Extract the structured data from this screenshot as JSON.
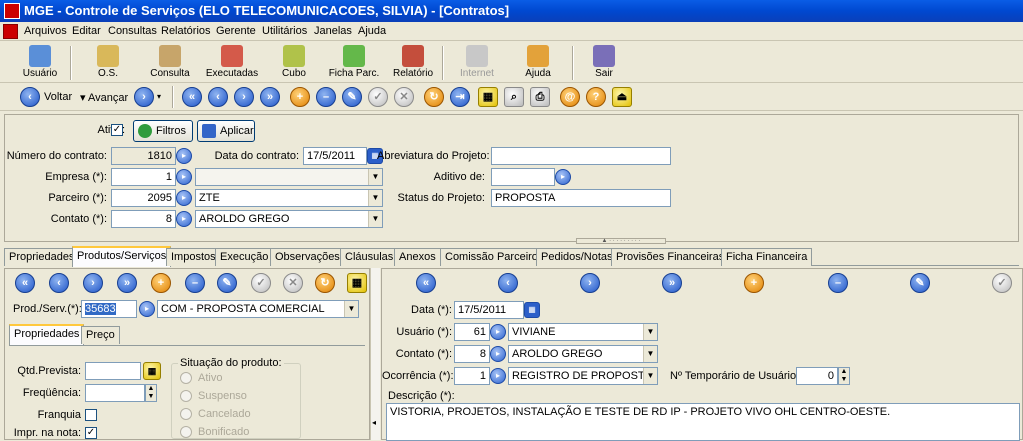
{
  "window": {
    "title": "MGE - Controle de Serviços (ELO TELECOMUNICACOES, SILVIA) - [Contratos]"
  },
  "menu": [
    "Arquivos",
    "Editar",
    "Consultas",
    "Relatórios",
    "Gerente",
    "Utilitários",
    "Janelas",
    "Ajuda"
  ],
  "toolbar1": [
    {
      "label": "Usuário",
      "icon": "user-icon"
    },
    {
      "label": "O.S.",
      "icon": "service-order-icon"
    },
    {
      "label": "Consulta",
      "icon": "query-icon"
    },
    {
      "label": "Executadas",
      "icon": "executed-icon"
    },
    {
      "label": "Cubo",
      "icon": "cube-icon"
    },
    {
      "label": "Ficha Parc.",
      "icon": "partial-sheet-icon"
    },
    {
      "label": "Relatório",
      "icon": "report-icon"
    },
    {
      "label": "Internet",
      "icon": "internet-icon"
    },
    {
      "label": "Ajuda",
      "icon": "help-icon"
    },
    {
      "label": "Sair",
      "icon": "exit-icon"
    }
  ],
  "nav": {
    "back": "Voltar",
    "forward": "Avançar"
  },
  "form": {
    "ativo_label": "Ativo:",
    "filtros": "Filtros",
    "aplicar": "Aplicar",
    "numero_label": "Número do contrato:",
    "numero_value": "1810",
    "data_label": "Data do contrato:",
    "data_value": "17/5/2011",
    "abrev_label": "Abreviatura do Projeto:",
    "abrev_value": "",
    "empresa_label": "Empresa (*):",
    "empresa_code": "1",
    "empresa_name": "",
    "aditivo_label": "Aditivo de:",
    "aditivo_value": "",
    "parceiro_label": "Parceiro (*):",
    "parceiro_code": "2095",
    "parceiro_name": "ZTE",
    "status_label": "Status do Projeto:",
    "status_value": "PROPOSTA",
    "contato_label": "Contato (*):",
    "contato_code": "8",
    "contato_name": "AROLDO GREGO"
  },
  "tabs": [
    "Propriedades",
    "Produtos/Serviços",
    "Impostos",
    "Execução",
    "Observações",
    "Cláusulas",
    "Anexos",
    "Comissão Parceiros",
    "Pedidos/Notas",
    "Provisões Financeiras",
    "Ficha Financeira"
  ],
  "active_tab": "Produtos/Serviços",
  "left": {
    "prod_label": "Prod./Serv.(*):",
    "prod_code": "35683",
    "prod_name": "COM - PROPOSTA COMERCIAL",
    "subtabs": [
      "Propriedades",
      "Preço"
    ],
    "qtd_label": "Qtd.Prevista:",
    "qtd_value": "",
    "freq_label": "Freqüência:",
    "freq_value": "",
    "franquia_label": "Franquia",
    "impr_label": "Impr. na nota:",
    "situacao_title": "Situação do produto:",
    "situacao_options": [
      "Ativo",
      "Suspenso",
      "Cancelado",
      "Bonificado"
    ]
  },
  "right": {
    "data_label": "Data (*):",
    "data_value": "17/5/2011",
    "usuario_label": "Usuário (*):",
    "usuario_code": "61",
    "usuario_name": "VIVIANE",
    "contato_label": "Contato (*):",
    "contato_code": "8",
    "contato_name": "AROLDO GREGO",
    "ocorrencia_label": "Ocorrência (*):",
    "ocorrencia_code": "1",
    "ocorrencia_name": "REGISTRO DE PROPOSTA",
    "temp_label": "Nº Temporário de Usuários:",
    "temp_value": "0",
    "descricao_label": "Descrição (*):",
    "descricao_value": "VISTORIA, PROJETOS, INSTALAÇÃO E TESTE DE RD IP - PROJETO VIVO OHL CENTRO-OESTE."
  }
}
